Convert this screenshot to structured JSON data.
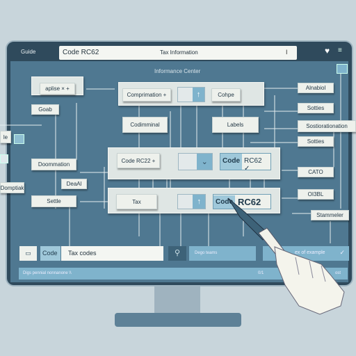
{
  "topbar": {
    "guide_label": "Guide",
    "address_code": "Code RC62",
    "address_title": "Tax Information",
    "cursor_glyph": "I"
  },
  "header": {
    "title": "Informance Center"
  },
  "nodes": {
    "aplise": "aplise  × +",
    "goab": "Goab",
    "le": "le",
    "doommation": "Doommation",
    "domptiak": "Domptiak",
    "deaal": "DeaAl",
    "settle": "Settle",
    "comprimation": "Comprimation +",
    "cohpe": "Cohpe",
    "codimminal": "Codimminal",
    "labels": "Labels",
    "code_rc22": "Code RC22 +",
    "code_rc62_mid_a": "Code",
    "code_rc62_mid_b": "RC62 ✓",
    "tax": "Tax",
    "code_rc62_low_a": "Code",
    "code_rc62_low_b": "RC62",
    "alnabiol": "Alnabiol",
    "sotties1": "Sotties",
    "sostio": "Sostiorationation",
    "sotties2": "Sotties",
    "cato": "CATO",
    "oi3bl": "OI3BL",
    "stammeler": "Stammeler"
  },
  "bottombar": {
    "code_label": "Code",
    "search_value": "Tax codes",
    "action_label": "Dego teams",
    "dropdown_value": "ex of example"
  },
  "status": {
    "left_text": "Digs pennial nonnanone \\\\",
    "middle_text": "0/1",
    "right_text": "ost"
  },
  "colors": {
    "screen": "#4f7891",
    "frame": "#2f4a5c",
    "accent": "#7fb3cc",
    "box": "#eef1ec"
  }
}
